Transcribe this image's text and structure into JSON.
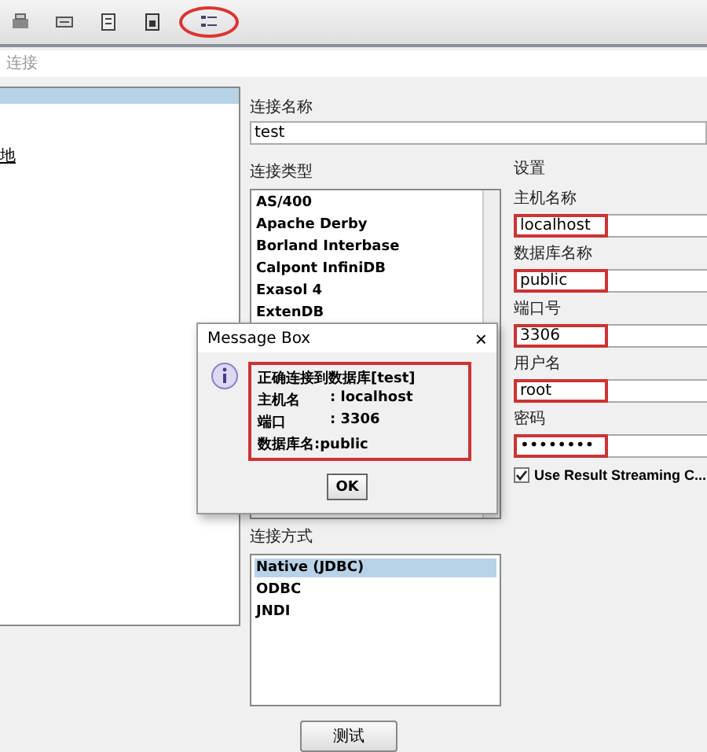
{
  "toolbar": {
    "buttons": [
      {
        "highlighted": false
      },
      {
        "highlighted": false
      },
      {
        "highlighted": false
      },
      {
        "highlighted": false
      },
      {
        "highlighted": true
      }
    ]
  },
  "breadcrumb": "连接",
  "tree": {
    "items": [
      {
        "selected": true
      },
      {
        "label": "地",
        "selected": false
      }
    ]
  },
  "connection_name": {
    "label": "连接名称",
    "value": "test"
  },
  "connection_type": {
    "label": "连接类型",
    "items": [
      {
        "label": "AS/400",
        "selected": false
      },
      {
        "label": "Apache Derby",
        "selected": false
      },
      {
        "label": "Borland Interbase",
        "selected": false
      },
      {
        "label": "Calpont InfiniDB",
        "selected": false
      },
      {
        "label": "Exasol 4",
        "selected": false
      },
      {
        "label": "ExtenDB",
        "selected": false
      }
    ]
  },
  "access": {
    "label": "连接方式",
    "items": [
      {
        "label": "Native (JDBC)",
        "selected": true
      },
      {
        "label": "ODBC",
        "selected": false
      },
      {
        "label": "JNDI",
        "selected": false
      }
    ]
  },
  "settings": {
    "title": "设置",
    "fields": [
      {
        "label": "主机名称",
        "value": "localhost",
        "highlighted": true
      },
      {
        "label": "数据库名称",
        "value": "public",
        "highlighted": true
      },
      {
        "label": "端口号",
        "value": "3306",
        "highlighted": true
      },
      {
        "label": "用户名",
        "value": "root",
        "highlighted": true
      },
      {
        "label": "密码",
        "value": "••••••••",
        "highlighted": true
      }
    ],
    "option": {
      "label": "Use Result Streaming C...",
      "checked": true
    }
  },
  "test_button": "测试",
  "dialog": {
    "title": "Message Box",
    "close": "×",
    "lines": [
      {
        "label": "正确连接到数据库[test]"
      },
      {
        "label": "主机名",
        "value": ": localhost"
      },
      {
        "label": "端口",
        "value": ": 3306"
      },
      {
        "label": "数据库名:public"
      }
    ],
    "highlighted": true,
    "button": "OK"
  }
}
